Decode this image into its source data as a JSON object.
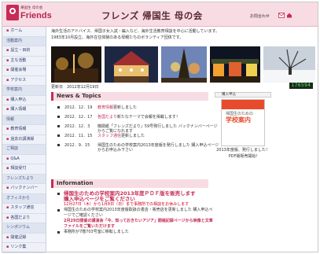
{
  "header": {
    "logo_sub": "帰国生 母の会",
    "logo_big": "Friends",
    "title": "フレンズ 帰国生 母の会",
    "link": "お問合わせ"
  },
  "sidebar": {
    "items": [
      {
        "label": "ホーム",
        "head": false
      },
      {
        "label": "活動案内",
        "head": true
      },
      {
        "label": "設立・目的",
        "head": false
      },
      {
        "label": "主な活動",
        "head": false
      },
      {
        "label": "開催会場",
        "head": false
      },
      {
        "label": "アクセス",
        "head": false
      },
      {
        "label": "学校案内",
        "head": true
      },
      {
        "label": "購入申込",
        "head": false
      },
      {
        "label": "購入情報",
        "head": false
      },
      {
        "label": "情報",
        "head": true
      },
      {
        "label": "教育情報",
        "head": false
      },
      {
        "label": "過去の講演録",
        "head": false
      },
      {
        "label": "ご相談",
        "head": true
      },
      {
        "label": "Q&A",
        "head": false
      },
      {
        "label": "相談受付",
        "head": false
      },
      {
        "label": "フレンズたより",
        "head": true
      },
      {
        "label": "バックナンバー",
        "head": false
      },
      {
        "label": "オフィスから",
        "head": true
      },
      {
        "label": "スタッフ通信",
        "head": false
      },
      {
        "label": "各国だより",
        "head": false
      },
      {
        "label": "シンポジウム",
        "head": true
      },
      {
        "label": "開催記録",
        "head": false
      },
      {
        "label": "リンク集",
        "head": false
      }
    ]
  },
  "intro": {
    "line1": "海外生活のアドバイス、帰国子女入試・編入など、海外生活教育相談を中心に活動しています。",
    "line2": "1983年10月設立。海外在住体験のある母親たちのボランティア団体です。"
  },
  "updated": "更新日　2012年12月19日",
  "counter": "176594",
  "news": {
    "title": "News & Topics",
    "items": [
      {
        "date": "2012．12．19",
        "hl": "教育情報",
        "rest": "更新しました"
      },
      {
        "date": "2012．12．17",
        "hl": "各国だより",
        "rest": "新たなテーマで会報を掲載します！"
      },
      {
        "date": "2012．12．3",
        "hl": "",
        "rest": "機関紙「フレンズだより」59号発行しました バックナンバーページからご覧になれます"
      },
      {
        "date": "2012．11．15",
        "hl": "スタッフ通信",
        "rest": "更新しました"
      },
      {
        "date": "2012．9．15",
        "hl": "",
        "rest": "帰国生のための学校案内2013年度版を発行しました 購入申込ページからお申込み下さい"
      }
    ]
  },
  "side": {
    "tab": "購入申込",
    "book_title": "学校案内",
    "book_sub": "帰国生のための",
    "caption1": "2013年度版、発行しました！",
    "caption2": "PDF版販売開始!"
  },
  "info": {
    "title": "Information",
    "main1": "帰国生のための学校案内2013年度ＰＤＦ版を販売します",
    "main2": "購入申込ページをご覧ください",
    "row1": "12月27日（木）から1月8日（日）まで事務所での相談をお休みします",
    "row2": "帰国生のための学校案内2013年度版取扱の書店・販売店を更新しました 購入申込ページでご確認ください",
    "row3": "2月29日開催の講演会「今、知っておきたいアジア」開催記録ページから映像と文章ファイルをご覧いただけます",
    "row4": "事務所が7階703号室に移転しました"
  },
  "colors": {
    "header_bg": "#f8dce4",
    "accent": "#c72b56",
    "sidebar_bg": "#eef1f8",
    "link_blue": "#1f4fb4",
    "alert_red": "#d0021b"
  },
  "icons": [
    "mail-icon",
    "home-icon"
  ]
}
